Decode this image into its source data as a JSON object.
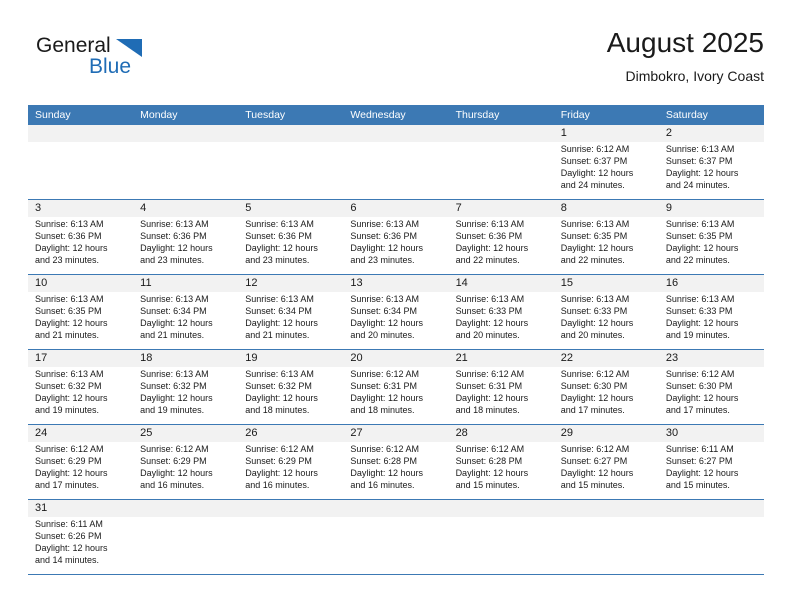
{
  "brand": {
    "name_part1": "General",
    "name_part2": "Blue",
    "triangle_icon": "triangle-icon",
    "accent_color": "#1f6cb5"
  },
  "header": {
    "title": "August 2025",
    "subtitle": "Dimbokro, Ivory Coast"
  },
  "theme": {
    "header_blue": "#3c79b4",
    "date_band_gray": "#f2f2f2",
    "text_color": "#1a1a1a"
  },
  "weekdays": [
    "Sunday",
    "Monday",
    "Tuesday",
    "Wednesday",
    "Thursday",
    "Friday",
    "Saturday"
  ],
  "weeks": [
    [
      {
        "day": "",
        "lines": []
      },
      {
        "day": "",
        "lines": []
      },
      {
        "day": "",
        "lines": []
      },
      {
        "day": "",
        "lines": []
      },
      {
        "day": "",
        "lines": []
      },
      {
        "day": "1",
        "lines": [
          "Sunrise: 6:12 AM",
          "Sunset: 6:37 PM",
          "Daylight: 12 hours",
          "and 24 minutes."
        ]
      },
      {
        "day": "2",
        "lines": [
          "Sunrise: 6:13 AM",
          "Sunset: 6:37 PM",
          "Daylight: 12 hours",
          "and 24 minutes."
        ]
      }
    ],
    [
      {
        "day": "3",
        "lines": [
          "Sunrise: 6:13 AM",
          "Sunset: 6:36 PM",
          "Daylight: 12 hours",
          "and 23 minutes."
        ]
      },
      {
        "day": "4",
        "lines": [
          "Sunrise: 6:13 AM",
          "Sunset: 6:36 PM",
          "Daylight: 12 hours",
          "and 23 minutes."
        ]
      },
      {
        "day": "5",
        "lines": [
          "Sunrise: 6:13 AM",
          "Sunset: 6:36 PM",
          "Daylight: 12 hours",
          "and 23 minutes."
        ]
      },
      {
        "day": "6",
        "lines": [
          "Sunrise: 6:13 AM",
          "Sunset: 6:36 PM",
          "Daylight: 12 hours",
          "and 23 minutes."
        ]
      },
      {
        "day": "7",
        "lines": [
          "Sunrise: 6:13 AM",
          "Sunset: 6:36 PM",
          "Daylight: 12 hours",
          "and 22 minutes."
        ]
      },
      {
        "day": "8",
        "lines": [
          "Sunrise: 6:13 AM",
          "Sunset: 6:35 PM",
          "Daylight: 12 hours",
          "and 22 minutes."
        ]
      },
      {
        "day": "9",
        "lines": [
          "Sunrise: 6:13 AM",
          "Sunset: 6:35 PM",
          "Daylight: 12 hours",
          "and 22 minutes."
        ]
      }
    ],
    [
      {
        "day": "10",
        "lines": [
          "Sunrise: 6:13 AM",
          "Sunset: 6:35 PM",
          "Daylight: 12 hours",
          "and 21 minutes."
        ]
      },
      {
        "day": "11",
        "lines": [
          "Sunrise: 6:13 AM",
          "Sunset: 6:34 PM",
          "Daylight: 12 hours",
          "and 21 minutes."
        ]
      },
      {
        "day": "12",
        "lines": [
          "Sunrise: 6:13 AM",
          "Sunset: 6:34 PM",
          "Daylight: 12 hours",
          "and 21 minutes."
        ]
      },
      {
        "day": "13",
        "lines": [
          "Sunrise: 6:13 AM",
          "Sunset: 6:34 PM",
          "Daylight: 12 hours",
          "and 20 minutes."
        ]
      },
      {
        "day": "14",
        "lines": [
          "Sunrise: 6:13 AM",
          "Sunset: 6:33 PM",
          "Daylight: 12 hours",
          "and 20 minutes."
        ]
      },
      {
        "day": "15",
        "lines": [
          "Sunrise: 6:13 AM",
          "Sunset: 6:33 PM",
          "Daylight: 12 hours",
          "and 20 minutes."
        ]
      },
      {
        "day": "16",
        "lines": [
          "Sunrise: 6:13 AM",
          "Sunset: 6:33 PM",
          "Daylight: 12 hours",
          "and 19 minutes."
        ]
      }
    ],
    [
      {
        "day": "17",
        "lines": [
          "Sunrise: 6:13 AM",
          "Sunset: 6:32 PM",
          "Daylight: 12 hours",
          "and 19 minutes."
        ]
      },
      {
        "day": "18",
        "lines": [
          "Sunrise: 6:13 AM",
          "Sunset: 6:32 PM",
          "Daylight: 12 hours",
          "and 19 minutes."
        ]
      },
      {
        "day": "19",
        "lines": [
          "Sunrise: 6:13 AM",
          "Sunset: 6:32 PM",
          "Daylight: 12 hours",
          "and 18 minutes."
        ]
      },
      {
        "day": "20",
        "lines": [
          "Sunrise: 6:12 AM",
          "Sunset: 6:31 PM",
          "Daylight: 12 hours",
          "and 18 minutes."
        ]
      },
      {
        "day": "21",
        "lines": [
          "Sunrise: 6:12 AM",
          "Sunset: 6:31 PM",
          "Daylight: 12 hours",
          "and 18 minutes."
        ]
      },
      {
        "day": "22",
        "lines": [
          "Sunrise: 6:12 AM",
          "Sunset: 6:30 PM",
          "Daylight: 12 hours",
          "and 17 minutes."
        ]
      },
      {
        "day": "23",
        "lines": [
          "Sunrise: 6:12 AM",
          "Sunset: 6:30 PM",
          "Daylight: 12 hours",
          "and 17 minutes."
        ]
      }
    ],
    [
      {
        "day": "24",
        "lines": [
          "Sunrise: 6:12 AM",
          "Sunset: 6:29 PM",
          "Daylight: 12 hours",
          "and 17 minutes."
        ]
      },
      {
        "day": "25",
        "lines": [
          "Sunrise: 6:12 AM",
          "Sunset: 6:29 PM",
          "Daylight: 12 hours",
          "and 16 minutes."
        ]
      },
      {
        "day": "26",
        "lines": [
          "Sunrise: 6:12 AM",
          "Sunset: 6:29 PM",
          "Daylight: 12 hours",
          "and 16 minutes."
        ]
      },
      {
        "day": "27",
        "lines": [
          "Sunrise: 6:12 AM",
          "Sunset: 6:28 PM",
          "Daylight: 12 hours",
          "and 16 minutes."
        ]
      },
      {
        "day": "28",
        "lines": [
          "Sunrise: 6:12 AM",
          "Sunset: 6:28 PM",
          "Daylight: 12 hours",
          "and 15 minutes."
        ]
      },
      {
        "day": "29",
        "lines": [
          "Sunrise: 6:12 AM",
          "Sunset: 6:27 PM",
          "Daylight: 12 hours",
          "and 15 minutes."
        ]
      },
      {
        "day": "30",
        "lines": [
          "Sunrise: 6:11 AM",
          "Sunset: 6:27 PM",
          "Daylight: 12 hours",
          "and 15 minutes."
        ]
      }
    ],
    [
      {
        "day": "31",
        "lines": [
          "Sunrise: 6:11 AM",
          "Sunset: 6:26 PM",
          "Daylight: 12 hours",
          "and 14 minutes."
        ]
      },
      {
        "day": "",
        "lines": []
      },
      {
        "day": "",
        "lines": []
      },
      {
        "day": "",
        "lines": []
      },
      {
        "day": "",
        "lines": []
      },
      {
        "day": "",
        "lines": []
      },
      {
        "day": "",
        "lines": []
      }
    ]
  ]
}
